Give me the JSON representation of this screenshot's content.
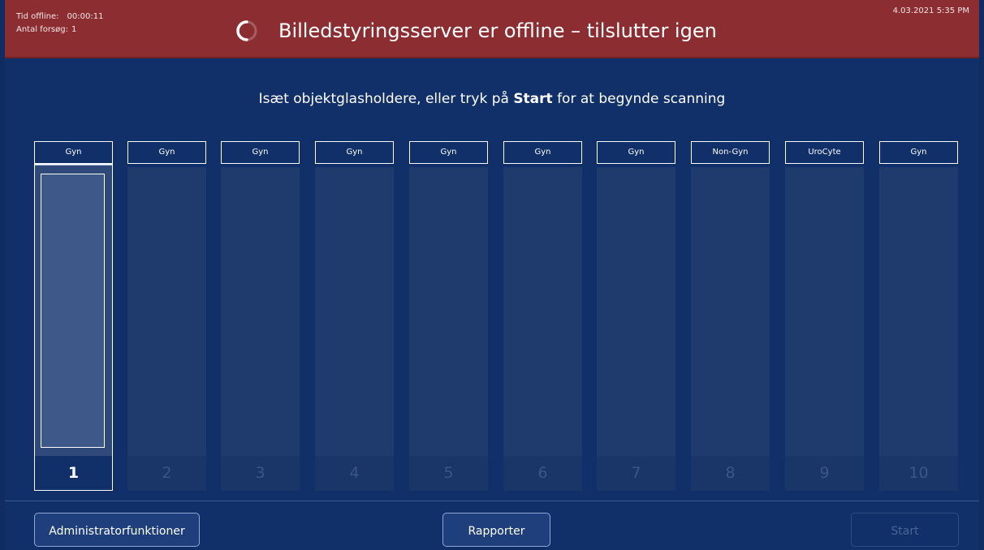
{
  "header": {
    "offline_time_label": "Tid offline:",
    "offline_time_value": "00:00:11",
    "attempts_label": "Antal forsøg:",
    "attempts_value": "1",
    "title": "Billedstyringsserver er offline – tilslutter igen",
    "timestamp": "4.03.2021 5:35 PM",
    "spinner_icon": "loading-spinner-icon",
    "colors": {
      "background": "#8b2d31"
    }
  },
  "instruction": {
    "before": "Isæt objektglasholdere, eller tryk på ",
    "bold": "Start",
    "after": " for at begynde scanning"
  },
  "slots": [
    {
      "label": "Gyn",
      "number": "1",
      "state": "loaded"
    },
    {
      "label": "Gyn",
      "number": "2",
      "state": "empty"
    },
    {
      "label": "Gyn",
      "number": "3",
      "state": "empty"
    },
    {
      "label": "Gyn",
      "number": "4",
      "state": "empty"
    },
    {
      "label": "Gyn",
      "number": "5",
      "state": "empty"
    },
    {
      "label": "Gyn",
      "number": "6",
      "state": "empty"
    },
    {
      "label": "Gyn",
      "number": "7",
      "state": "empty"
    },
    {
      "label": "Non-Gyn",
      "number": "8",
      "state": "empty"
    },
    {
      "label": "UroCyte",
      "number": "9",
      "state": "empty"
    },
    {
      "label": "Gyn",
      "number": "10",
      "state": "empty"
    }
  ],
  "footer": {
    "admin_label": "Administratorfunktioner",
    "reports_label": "Rapporter",
    "start_label": "Start",
    "start_enabled": false
  }
}
